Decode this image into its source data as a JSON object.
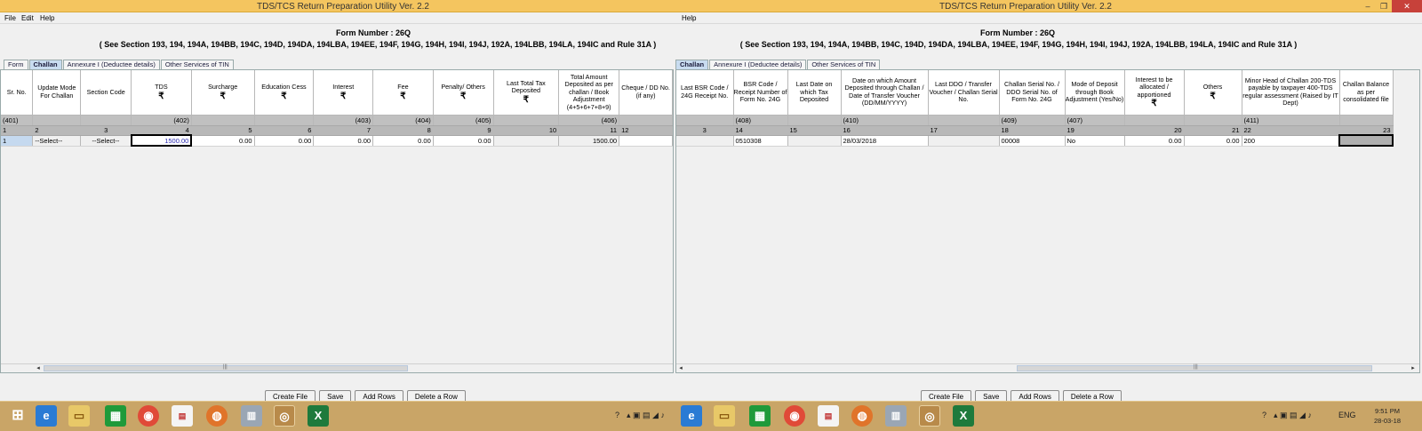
{
  "window": {
    "title": "TDS/TCS Return Preparation Utility Ver. 2.2",
    "controls": {
      "minimize": "–",
      "restore": "❐",
      "close": "✕"
    }
  },
  "menu": {
    "file": "File",
    "edit": "Edit",
    "help": "Help"
  },
  "header": {
    "form_number": "Form Number : 26Q",
    "section_text": "( See Section 193, 194, 194A, 194BB, 194C, 194D, 194DA, 194LBA, 194EE, 194F, 194G, 194H, 194I, 194J, 192A, 194LBB, 194LA, 194IC and Rule 31A )"
  },
  "tabs": {
    "form": "Form",
    "challan": "Challan",
    "annexure": "Annexure I (Deductee details)",
    "other": "Other Services of TIN"
  },
  "rupee": "₹",
  "left_table": {
    "headers": {
      "sr": "Sr. No.",
      "mode": "Update Mode For Challan",
      "section": "Section Code",
      "tds": "TDS",
      "surcharge": "Surcharge",
      "cess": "Education Cess",
      "interest": "Interest",
      "fee": "Fee",
      "penalty": "Penalty/ Others",
      "lasttotal": "Last Total Tax Deposited",
      "total": "Total Amount Deposited as per challan / Book Adjustment (4+5+6+7+8+9)",
      "cheque": "Cheque / DD No. (if any)"
    },
    "codes": {
      "sr": "(401)",
      "tds": "(402)",
      "interest": "(403)",
      "fee": "(404)",
      "penalty": "(405)",
      "total": "(406)"
    },
    "nums": {
      "sr": "1",
      "mode": "2",
      "section": "3",
      "tds": "4",
      "surcharge": "5",
      "cess": "6",
      "interest": "7",
      "fee": "8",
      "penalty": "9",
      "lasttotal": "10",
      "total": "11",
      "cheque": "12"
    },
    "row": {
      "sr": "1",
      "mode": "--Select--",
      "section": "--Select--",
      "tds": "1500.00",
      "surcharge": "0.00",
      "cess": "0.00",
      "interest": "0.00",
      "fee": "0.00",
      "penalty": "0.00",
      "total": "1500.00"
    }
  },
  "right_table": {
    "headers": {
      "lastbsr": "Last BSR Code / 24G Receipt No.",
      "bsr": "BSR Code / Receipt Number of Form No. 24G",
      "lastdate": "Last Date on which Tax Deposited",
      "date": "Date on which Amount Deposited through Challan / Date of Transfer Voucher (DD/MM/YYYY)",
      "lastddo": "Last DDO / Transfer Voucher / Challan Serial No.",
      "serial": "Challan Serial No. / DDO Serial No. of Form No. 24G",
      "mode": "Mode of Deposit through Book Adjustment (Yes/No)",
      "interest": "Interest to be allocated / apportioned",
      "others": "Others",
      "minor": "Minor Head of Challan 200-TDS payable by taxpayer 400-TDS regular assessment (Raised by IT Dept)",
      "balance": "Challan Balance as per consolidated file"
    },
    "codes": {
      "bsr": "(408)",
      "date": "(410)",
      "serial": "(409)",
      "mode": "(407)",
      "minor": "(411)"
    },
    "nums": {
      "lastbsr": "3",
      "bsr": "14",
      "lastdate": "15",
      "date": "16",
      "lastddo": "17",
      "serial": "18",
      "mode": "19",
      "interest": "20",
      "others": "21",
      "minor": "22",
      "balance": "23"
    },
    "row": {
      "bsr": "0510308",
      "date": "28/03/2018",
      "serial": "00008",
      "mode": "No",
      "interest": "0.00",
      "others": "0.00",
      "minor": "200"
    }
  },
  "buttons": {
    "create": "Create File",
    "save": "Save",
    "add": "Add Rows",
    "delete": "Delete a Row"
  },
  "scroll": {
    "left_arrow": "◂",
    "right_arrow": "▸",
    "grip": "|||"
  },
  "taskbar": {
    "start_icon": "windows-icon",
    "language": "ENG",
    "time": "9:51 PM",
    "date": "28-03-18"
  },
  "colors": {
    "titlebar": "#f4c55f",
    "taskbar": "#c9a567",
    "active_tab": "#c8dcf0",
    "selected_row": "#c5d9ef"
  }
}
